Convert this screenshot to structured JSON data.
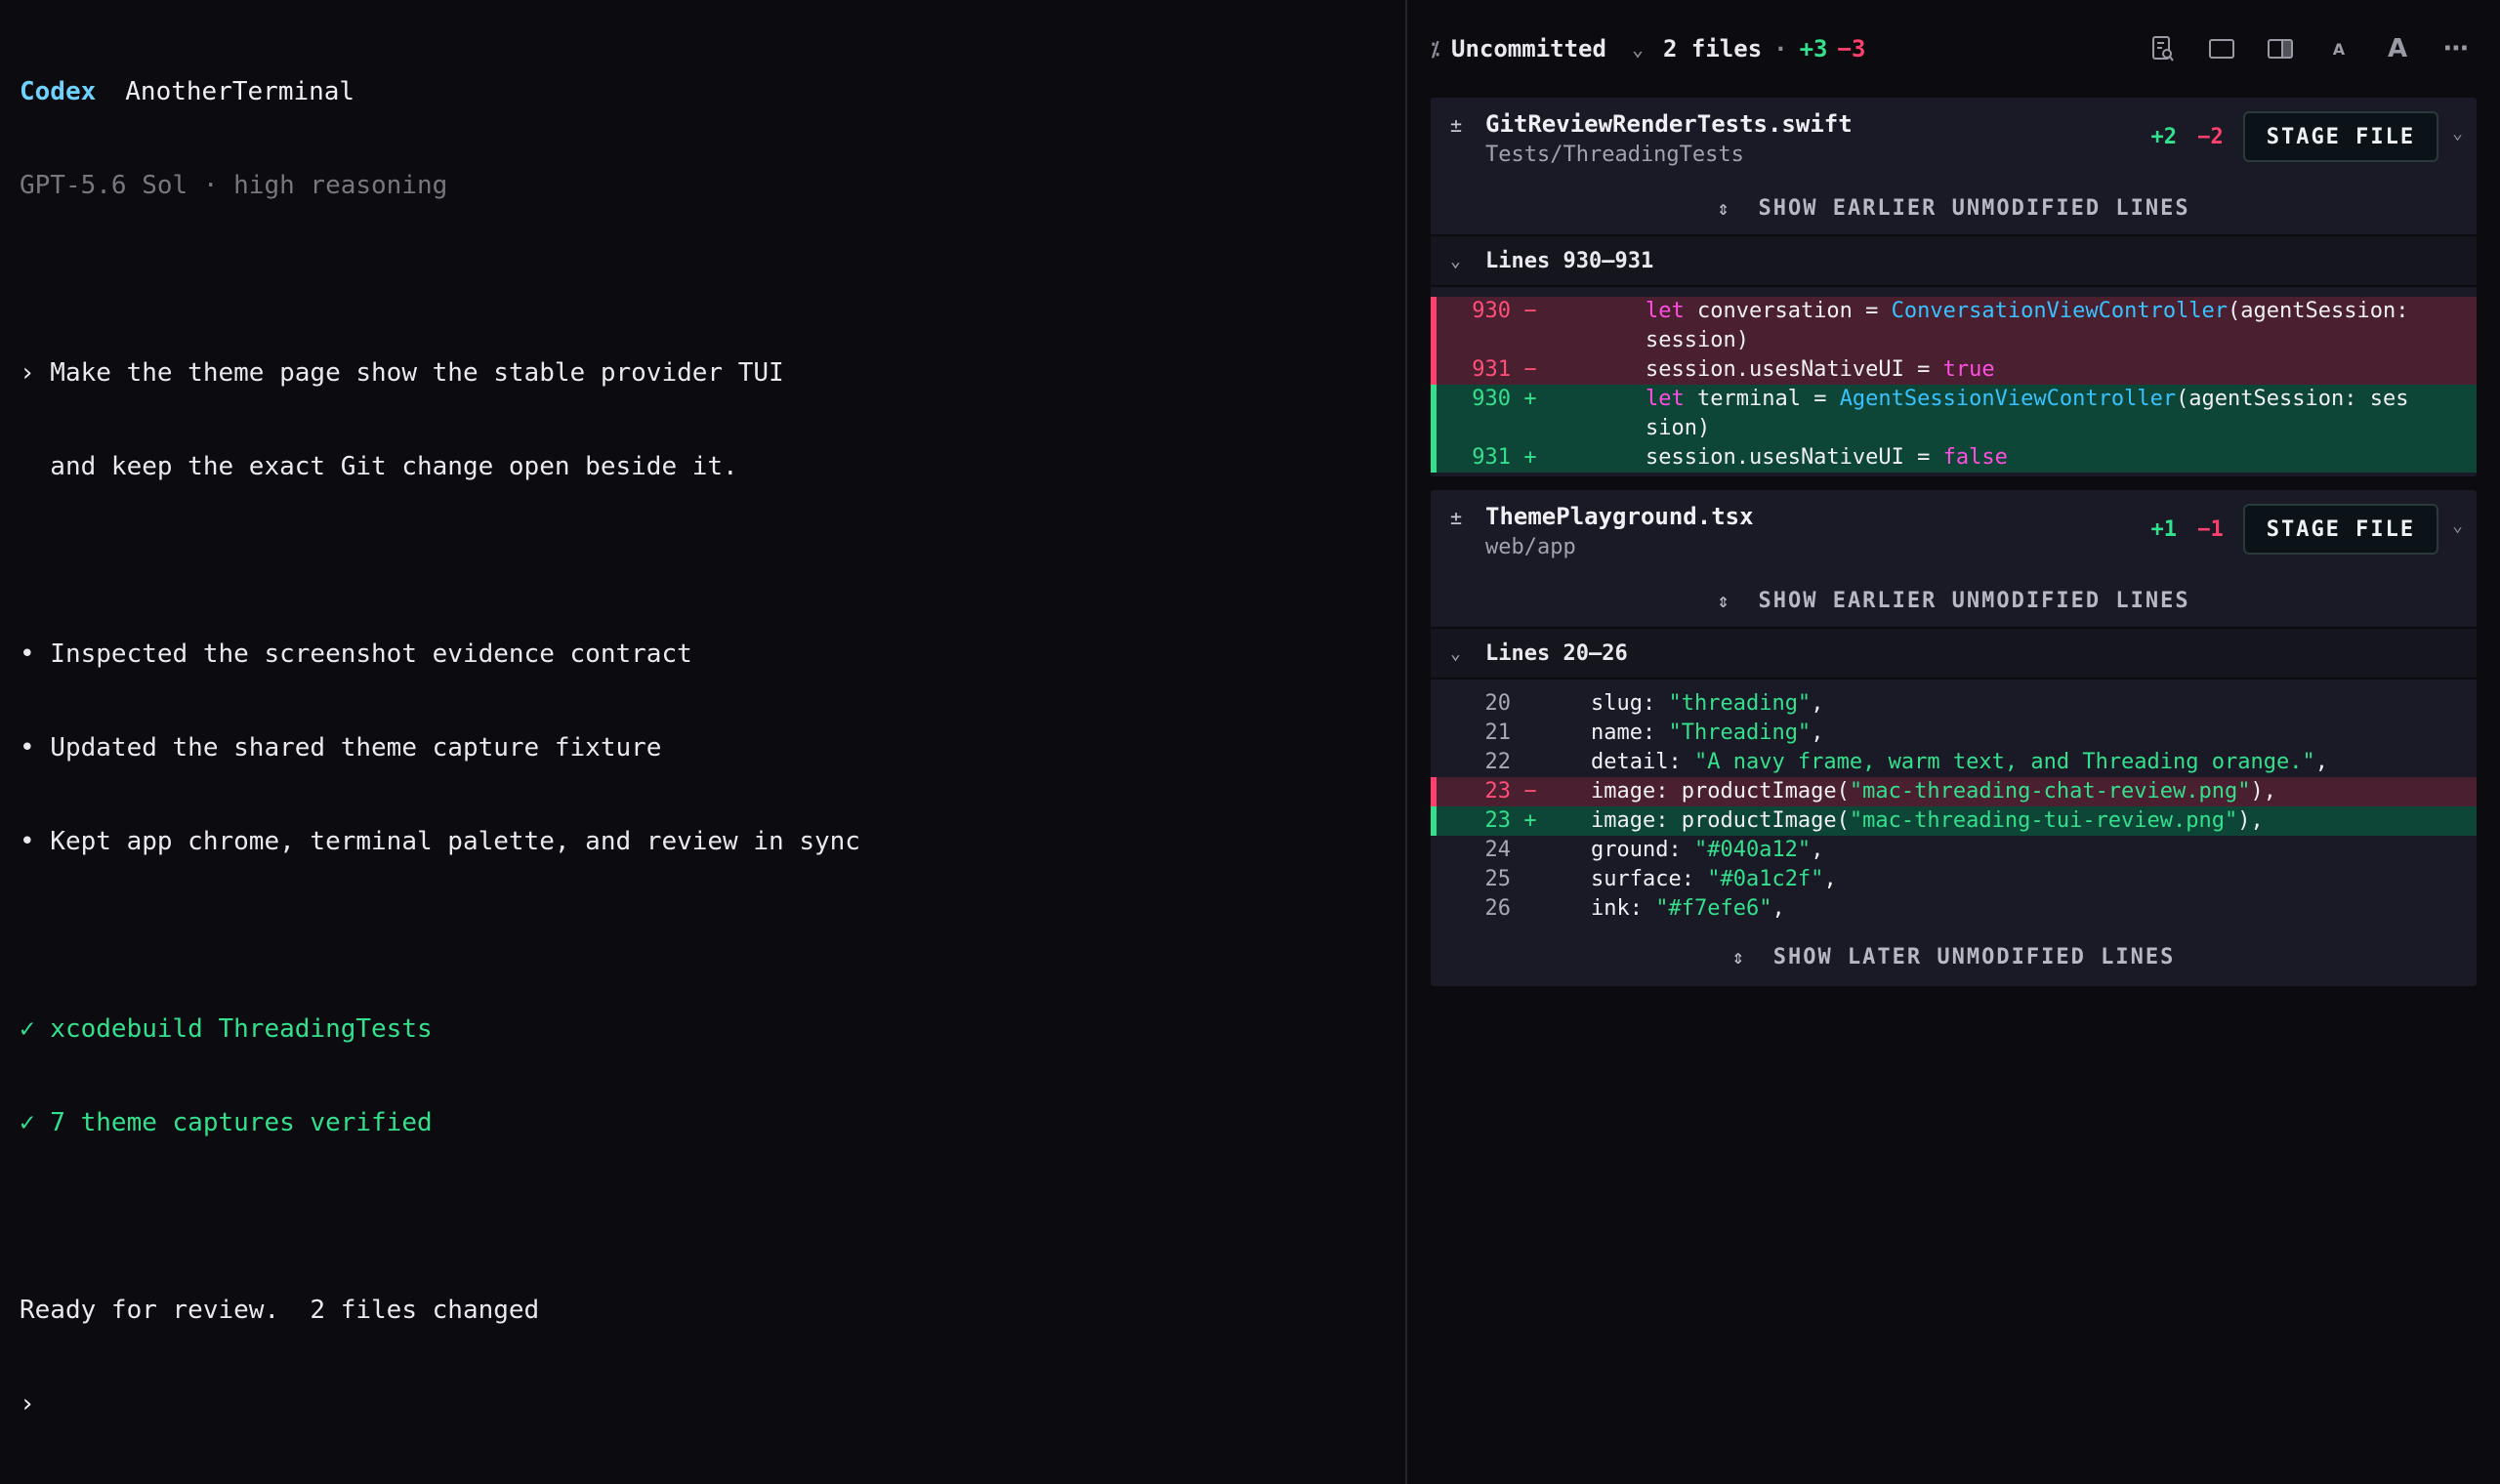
{
  "terminal": {
    "brand": "Codex",
    "project": "AnotherTerminal",
    "model_line": "GPT-5.6 Sol · high reasoning",
    "prompt_lines": [
      "› Make the theme page show the stable provider TUI",
      "  and keep the exact Git change open beside it."
    ],
    "bullets": [
      "• Inspected the screenshot evidence contract",
      "• Updated the shared theme capture fixture",
      "• Kept app chrome, terminal palette, and review in sync"
    ],
    "checks": [
      "✓ xcodebuild ThreadingTests",
      "✓ 7 theme captures verified"
    ],
    "summary": "Ready for review.  2 files changed",
    "cursor_prompt": "›"
  },
  "review": {
    "scope_label": "Uncommitted",
    "files_count": "2 files",
    "dot": "·",
    "added_total": "+3",
    "removed_total": "−3",
    "icons": [
      "document-search-icon",
      "single-pane-icon",
      "split-pane-icon",
      "font-small-icon",
      "font-large-icon",
      "more-icon"
    ],
    "icon_glyphs": {
      "font_small": "A",
      "font_large": "A",
      "more": "⋯"
    },
    "files": [
      {
        "name": "GitReviewRenderTests.swift",
        "path": "Tests/ThreadingTests",
        "added": "+2",
        "removed": "−2",
        "stage_label": "STAGE FILE",
        "expand_top": "SHOW EARLIER UNMODIFIED LINES",
        "hunk_label": "Lines 930–931"
      },
      {
        "name": "ThemePlayground.tsx",
        "path": "web/app",
        "added": "+1",
        "removed": "−1",
        "stage_label": "STAGE FILE",
        "expand_top": "SHOW EARLIER UNMODIFIED LINES",
        "hunk_label": "Lines 20–26",
        "expand_bottom": "SHOW LATER UNMODIFIED LINES"
      }
    ],
    "swift_lines": [
      {
        "num": "930",
        "sign": "−",
        "type": "removed",
        "segments": [
          [
            "kw",
            "let"
          ],
          [
            "",
            "conversation = "
          ],
          [
            "ty",
            "ConversationViewController"
          ],
          [
            "",
            "(agentSession:"
          ]
        ]
      },
      {
        "num": "",
        "sign": "",
        "type": "removed",
        "segments": [
          [
            "",
            "session)"
          ]
        ]
      },
      {
        "num": "931",
        "sign": "−",
        "type": "removed",
        "segments": [
          [
            "",
            "session.usesNativeUI = "
          ],
          [
            "kw",
            "true"
          ]
        ]
      },
      {
        "num": "930",
        "sign": "+",
        "type": "added",
        "segments": [
          [
            "kw",
            "let"
          ],
          [
            "",
            "terminal = "
          ],
          [
            "ty",
            "AgentSessionViewController"
          ],
          [
            "",
            "(agentSession: ses"
          ]
        ]
      },
      {
        "num": "",
        "sign": "",
        "type": "added",
        "segments": [
          [
            "",
            "sion)"
          ]
        ]
      },
      {
        "num": "931",
        "sign": "+",
        "type": "added",
        "segments": [
          [
            "",
            "session.usesNativeUI = "
          ],
          [
            "kw",
            "false"
          ]
        ]
      }
    ],
    "tsx_lines": [
      {
        "num": "20",
        "sign": "",
        "type": "context",
        "segments": [
          [
            "",
            "slug: "
          ],
          [
            "str",
            "\"threading\""
          ],
          [
            "",
            ","
          ]
        ]
      },
      {
        "num": "21",
        "sign": "",
        "type": "context",
        "segments": [
          [
            "",
            "name: "
          ],
          [
            "str",
            "\"Threading\""
          ],
          [
            "",
            ","
          ]
        ]
      },
      {
        "num": "22",
        "sign": "",
        "type": "context",
        "segments": [
          [
            "",
            "detail: "
          ],
          [
            "str",
            "\"A navy frame, warm text, and Threading orange.\""
          ],
          [
            "",
            ","
          ]
        ]
      },
      {
        "num": "23",
        "sign": "−",
        "type": "removed",
        "segments": [
          [
            "",
            "image: productImage("
          ],
          [
            "str",
            "\"mac-threading-chat-review.png\""
          ],
          [
            "",
            "),"
          ]
        ]
      },
      {
        "num": "23",
        "sign": "+",
        "type": "added",
        "segments": [
          [
            "",
            "image: productImage("
          ],
          [
            "str",
            "\"mac-threading-tui-review.png\""
          ],
          [
            "",
            "),"
          ]
        ]
      },
      {
        "num": "24",
        "sign": "",
        "type": "context",
        "segments": [
          [
            "",
            "ground: "
          ],
          [
            "str",
            "\"#040a12\""
          ],
          [
            "",
            ","
          ]
        ]
      },
      {
        "num": "25",
        "sign": "",
        "type": "context",
        "segments": [
          [
            "",
            "surface: "
          ],
          [
            "str",
            "\"#0a1c2f\""
          ],
          [
            "",
            ","
          ]
        ]
      },
      {
        "num": "26",
        "sign": "",
        "type": "context",
        "segments": [
          [
            "",
            "ink: "
          ],
          [
            "str",
            "\"#f7efe6\""
          ],
          [
            "",
            ","
          ]
        ]
      }
    ]
  }
}
